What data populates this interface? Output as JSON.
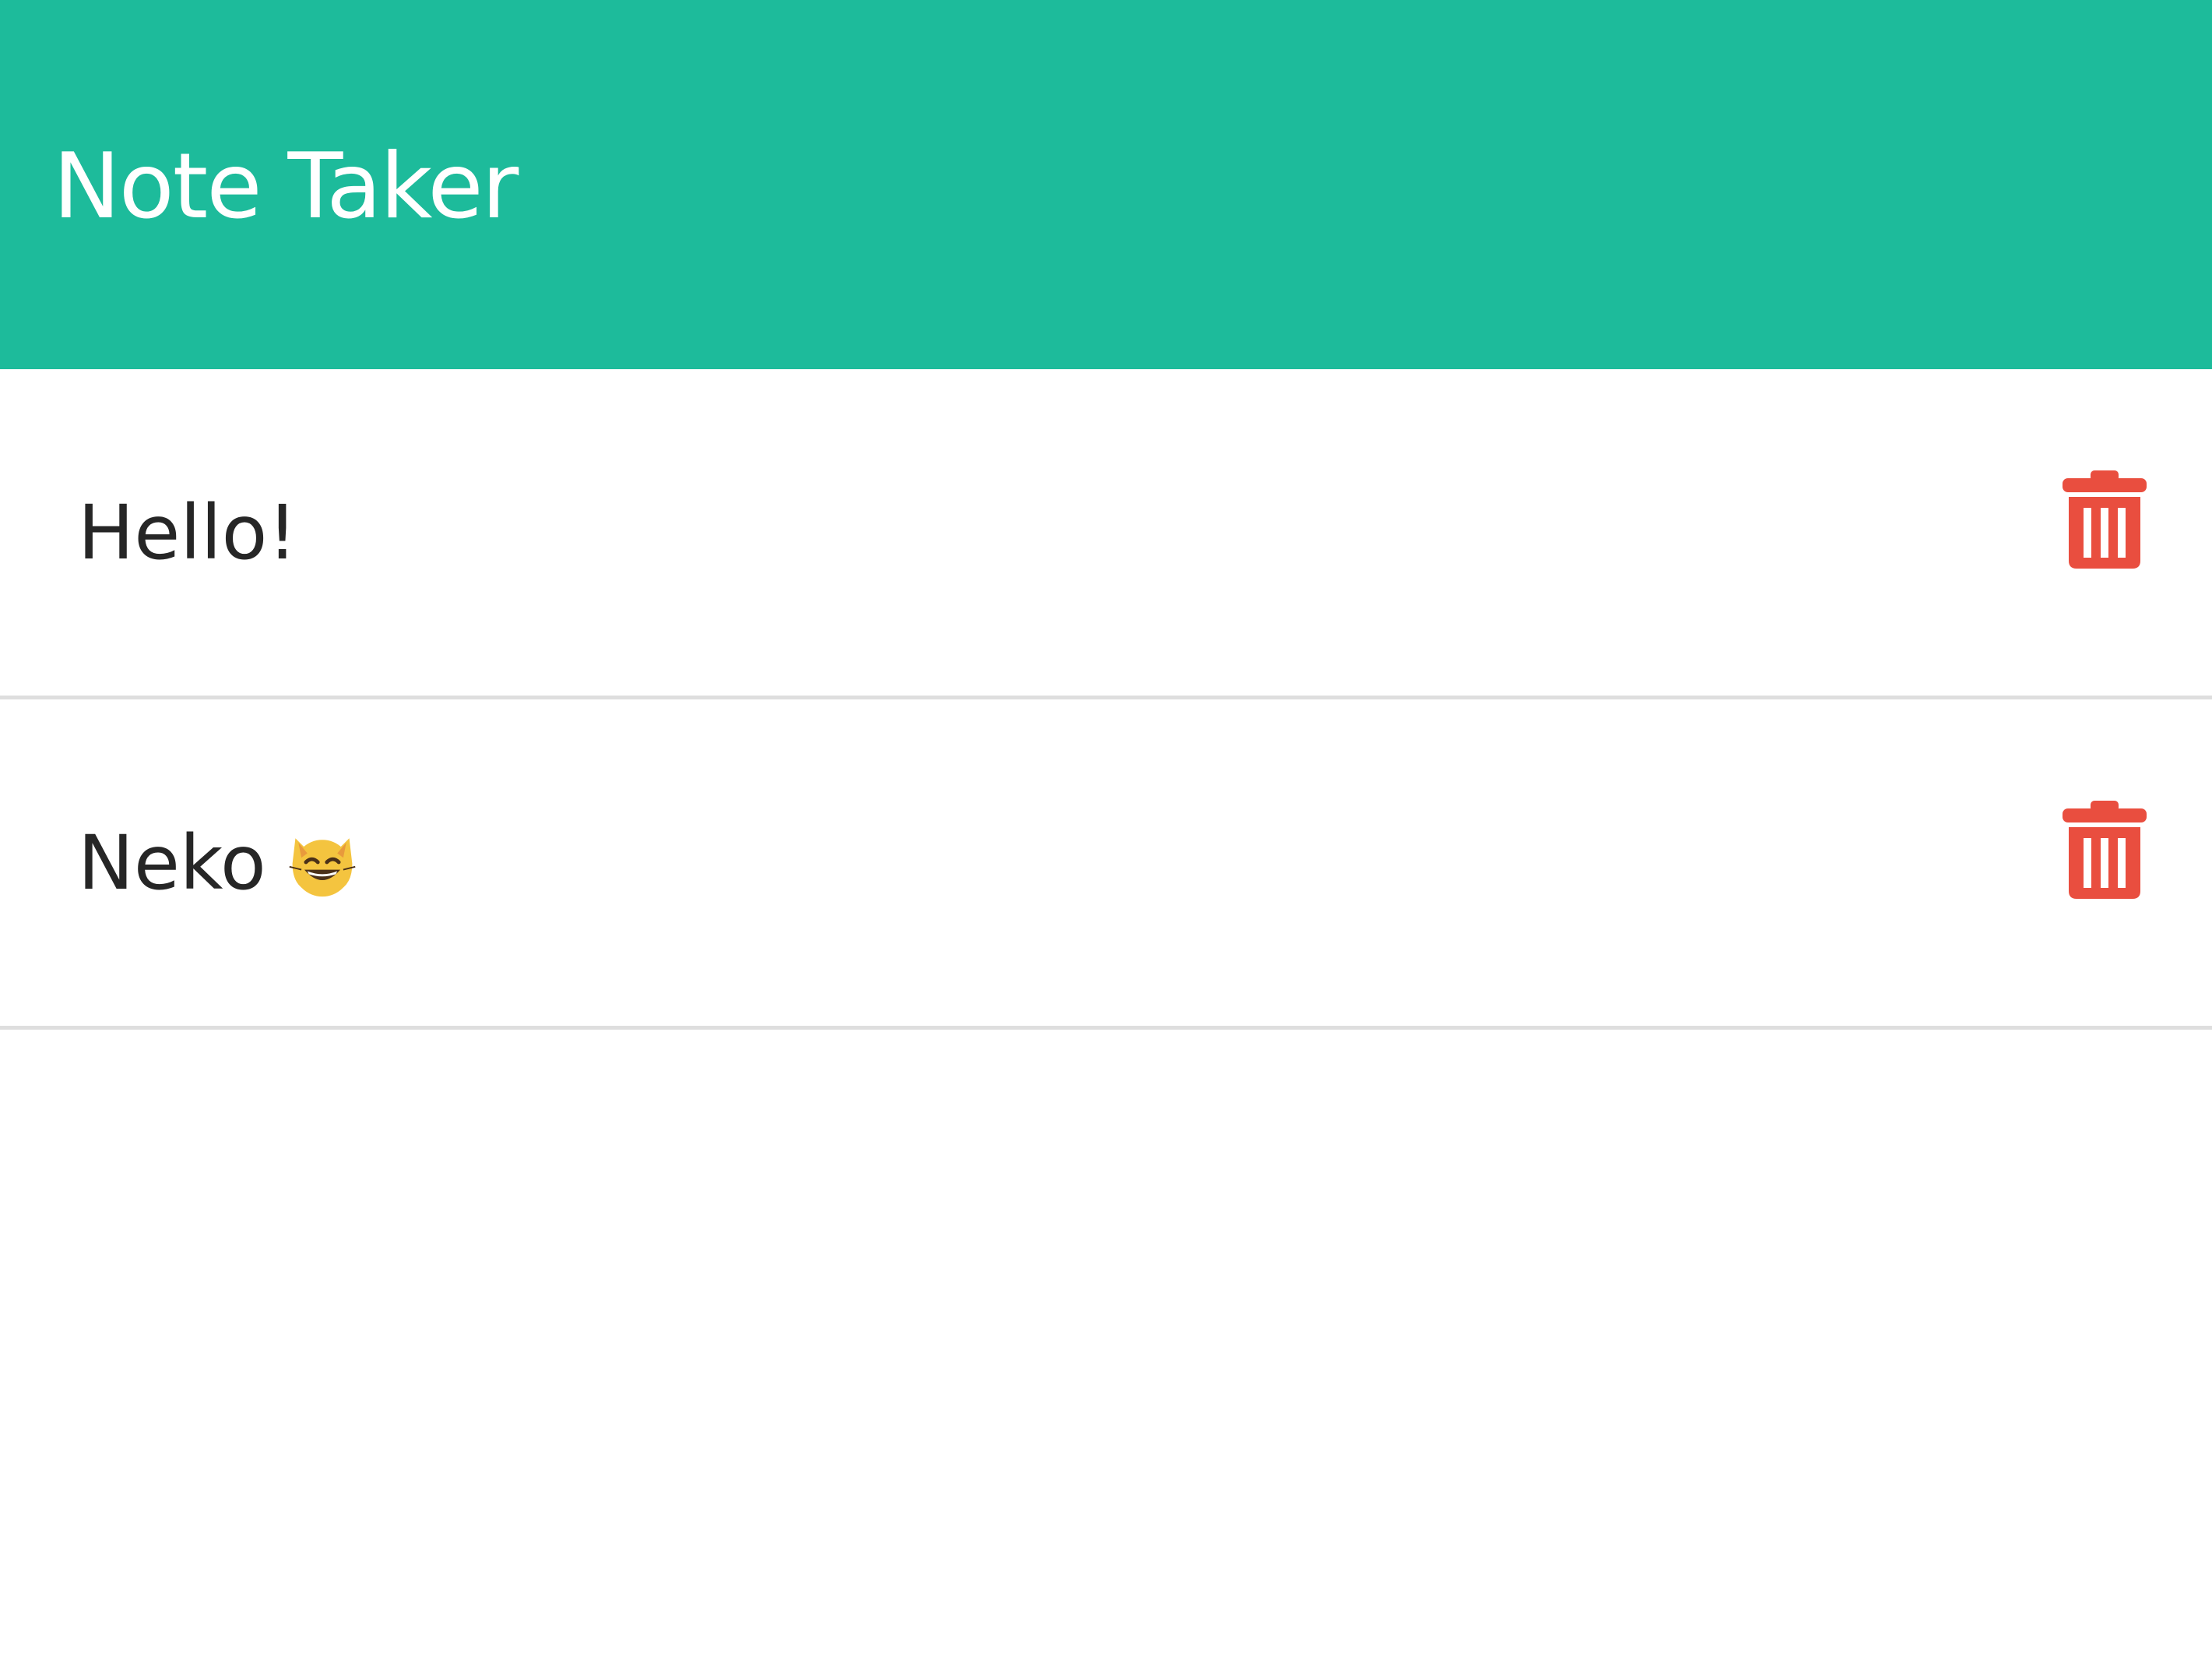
{
  "app": {
    "title": "Note Taker"
  },
  "notes": [
    {
      "text": "Hello!",
      "delete_icon": "trash-icon"
    },
    {
      "text": "Neko",
      "emoji": "😸",
      "emoji_icon": "grinning-cat-icon",
      "delete_icon": "trash-icon"
    }
  ],
  "colors": {
    "header_bg": "#1dbb9b",
    "header_text": "#ffffff",
    "note_text": "#262626",
    "delete_icon": "#e94e3f",
    "divider": "#dedede"
  }
}
